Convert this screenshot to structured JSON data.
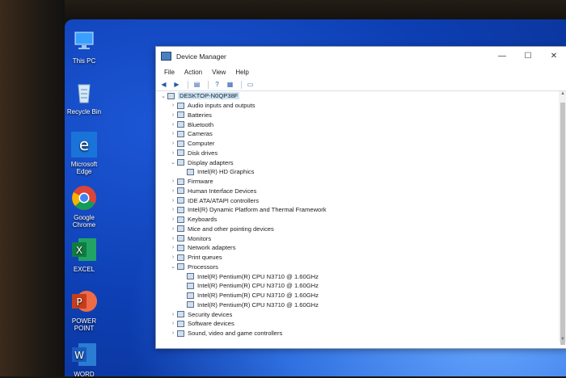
{
  "desktop": {
    "icons": [
      {
        "label": "This PC",
        "icon": "this-pc-icon"
      },
      {
        "label": "Recycle Bin",
        "icon": "recycle-bin-icon"
      },
      {
        "label": "Microsoft Edge",
        "icon": "edge-icon"
      },
      {
        "label": "Google Chrome",
        "icon": "chrome-icon"
      },
      {
        "label": "EXCEL",
        "icon": "excel-icon"
      },
      {
        "label": "POWER POINT",
        "icon": "powerpoint-icon"
      },
      {
        "label": "WORD",
        "icon": "word-icon"
      }
    ]
  },
  "window": {
    "title": "Device Manager",
    "controls": {
      "minimize": "—",
      "maximize": "☐",
      "close": "✕"
    },
    "menu": [
      "File",
      "Action",
      "View",
      "Help"
    ],
    "toolbar_icons": [
      "back-icon",
      "forward-icon",
      "properties-icon",
      "help-icon",
      "device-view-icon",
      "monitor-icon"
    ],
    "tree": [
      {
        "label": "DESKTOP-N0QP38F",
        "level": 0,
        "arrow": "⌄",
        "root": true
      },
      {
        "label": "Audio inputs and outputs",
        "level": 1,
        "arrow": "›"
      },
      {
        "label": "Batteries",
        "level": 1,
        "arrow": "›"
      },
      {
        "label": "Bluetooth",
        "level": 1,
        "arrow": "›"
      },
      {
        "label": "Cameras",
        "level": 1,
        "arrow": "›"
      },
      {
        "label": "Computer",
        "level": 1,
        "arrow": "›"
      },
      {
        "label": "Disk drives",
        "level": 1,
        "arrow": "›"
      },
      {
        "label": "Display adapters",
        "level": 1,
        "arrow": "⌄"
      },
      {
        "label": "Intel(R) HD Graphics",
        "level": 2,
        "arrow": ""
      },
      {
        "label": "Firmware",
        "level": 1,
        "arrow": "›"
      },
      {
        "label": "Human Interface Devices",
        "level": 1,
        "arrow": "›"
      },
      {
        "label": "IDE ATA/ATAPI controllers",
        "level": 1,
        "arrow": "›"
      },
      {
        "label": "Intel(R) Dynamic Platform and Thermal Framework",
        "level": 1,
        "arrow": "›"
      },
      {
        "label": "Keyboards",
        "level": 1,
        "arrow": "›"
      },
      {
        "label": "Mice and other pointing devices",
        "level": 1,
        "arrow": "›"
      },
      {
        "label": "Monitors",
        "level": 1,
        "arrow": "›"
      },
      {
        "label": "Network adapters",
        "level": 1,
        "arrow": "›"
      },
      {
        "label": "Print queues",
        "level": 1,
        "arrow": "›"
      },
      {
        "label": "Processors",
        "level": 1,
        "arrow": "⌄"
      },
      {
        "label": "Intel(R) Pentium(R) CPU  N3710  @ 1.60GHz",
        "level": 2,
        "arrow": ""
      },
      {
        "label": "Intel(R) Pentium(R) CPU  N3710  @ 1.60GHz",
        "level": 2,
        "arrow": ""
      },
      {
        "label": "Intel(R) Pentium(R) CPU  N3710  @ 1.60GHz",
        "level": 2,
        "arrow": ""
      },
      {
        "label": "Intel(R) Pentium(R) CPU  N3710  @ 1.60GHz",
        "level": 2,
        "arrow": ""
      },
      {
        "label": "Security devices",
        "level": 1,
        "arrow": "›"
      },
      {
        "label": "Software devices",
        "level": 1,
        "arrow": "›"
      },
      {
        "label": "Sound, video and game controllers",
        "level": 1,
        "arrow": "›"
      }
    ]
  },
  "colors": {
    "selection": "#cce4f7",
    "desktop": "#1d57d6"
  }
}
